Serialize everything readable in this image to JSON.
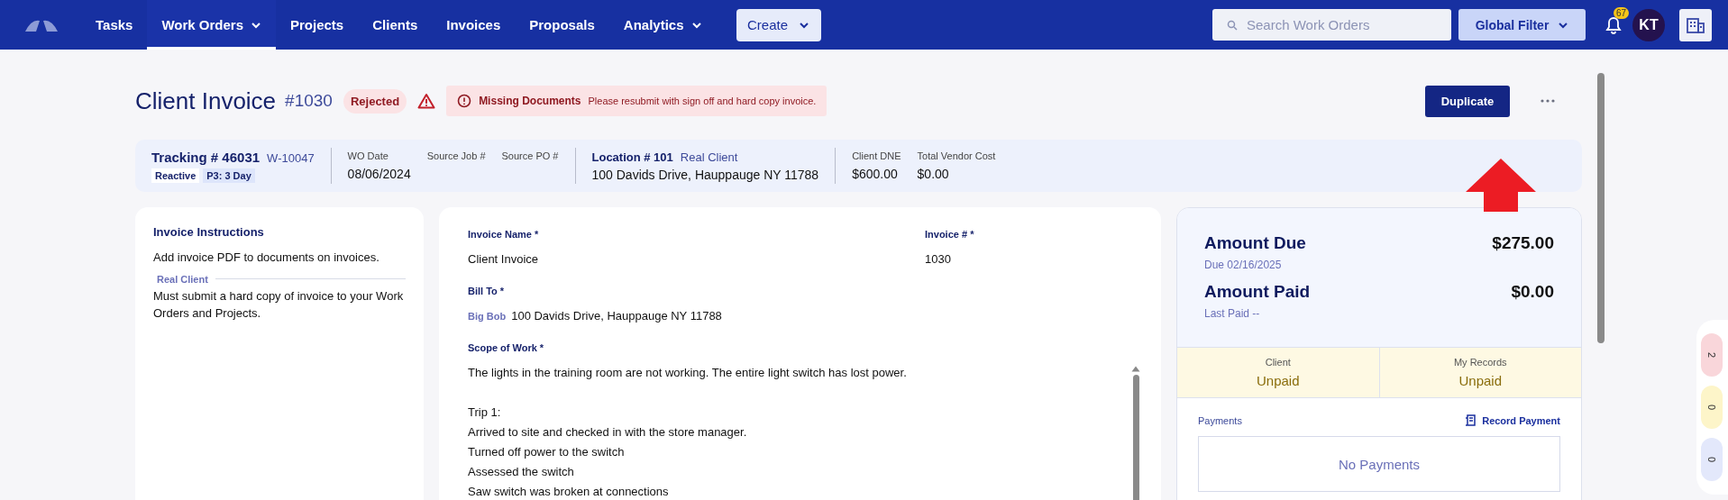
{
  "nav": {
    "items": [
      {
        "label": "Tasks",
        "selected": false,
        "dropdown": false
      },
      {
        "label": "Work Orders",
        "selected": true,
        "dropdown": true
      },
      {
        "label": "Projects",
        "selected": false,
        "dropdown": false
      },
      {
        "label": "Clients",
        "selected": false,
        "dropdown": false
      },
      {
        "label": "Invoices",
        "selected": false,
        "dropdown": false
      },
      {
        "label": "Proposals",
        "selected": false,
        "dropdown": false
      },
      {
        "label": "Analytics",
        "selected": false,
        "dropdown": true
      }
    ],
    "create_button": "Create",
    "search": {
      "placeholder": "Search Work Orders"
    },
    "global_filter": "Global Filter",
    "notification_count": "67",
    "avatar": "KT"
  },
  "header": {
    "title": "Client Invoice",
    "number": "#1030",
    "status": "Rejected",
    "alert": {
      "title": "Missing Documents",
      "message": "Please resubmit with sign off and hard copy invoice."
    },
    "primary_button": "Duplicate"
  },
  "tracking": {
    "tracking": "Tracking # 46031",
    "work_order": "W-10047",
    "tags": [
      {
        "label": "Reactive",
        "color": "#ffffff"
      },
      {
        "label": "P3: 3 Day",
        "color": "#dde5fb"
      }
    ],
    "dates": [
      {
        "label": "WO Date",
        "value": "08/06/2024"
      },
      {
        "label": "Source Job #"
      },
      {
        "label": "Source PO #"
      }
    ],
    "location": "Location # 101",
    "client": "Real Client",
    "address": "100 Davids Drive, Hauppauge NY 11788",
    "costs": [
      {
        "label": "Client DNE",
        "value": "$600.00"
      },
      {
        "label": "Total Vendor Cost",
        "value": "$0.00"
      }
    ]
  },
  "instructions": {
    "title": "Invoice Instructions",
    "text": "Add invoice PDF to documents on invoices.",
    "sections": [
      {
        "client": "Real Client",
        "text": "Must submit a hard copy of invoice to your Work Orders and Projects."
      }
    ]
  },
  "invoice": {
    "name_label": "Invoice Name *",
    "name": "Client Invoice",
    "number_label": "Invoice # *",
    "number": "1030",
    "bill_to_label": "Bill To *",
    "bill_to_name": "Big Bob",
    "bill_to_address": "100 Davids Drive, Hauppauge NY 11788",
    "scope_label": "Scope of Work *",
    "scope_paragraphs": [
      [
        "The lights in the training room are not working. The entire light switch has lost power."
      ],
      [
        "Trip 1:",
        "Arrived to site and checked in with the store manager.",
        "Turned off power to the switch",
        "Assessed the switch",
        "Saw switch was broken at connections"
      ]
    ]
  },
  "summary": {
    "amount_due_label": "Amount Due",
    "amount_due": "$275.00",
    "due_date": "Due 02/16/2025",
    "amount_paid_label": "Amount Paid",
    "amount_paid": "$0.00",
    "last_paid": "Last Paid --",
    "statuses": [
      {
        "label": "Client",
        "value": "Unpaid"
      },
      {
        "label": "My Records",
        "value": "Unpaid"
      }
    ],
    "payments_label": "Payments",
    "record_payment": "Record Payment",
    "empty": "No Payments"
  },
  "side_counters": [
    {
      "value": "2",
      "color": "#f9d6da"
    },
    {
      "value": "0",
      "color": "#fdf5c9"
    },
    {
      "value": "0",
      "color": "#e3e8fb"
    }
  ]
}
